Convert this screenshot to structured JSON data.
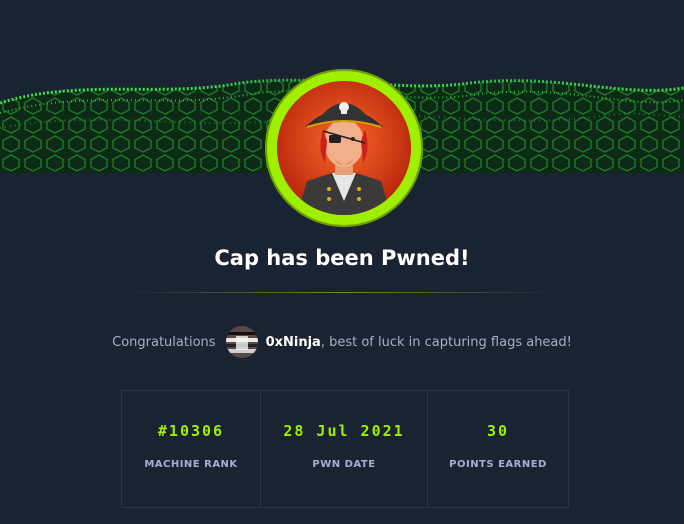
{
  "title": "Cap has been Pwned!",
  "congrats": {
    "prefix": "Congratulations",
    "username": "0xNinja",
    "suffix": ", best of luck in capturing flags ahead!"
  },
  "stats": [
    {
      "value": "#10306",
      "label": "MACHINE RANK"
    },
    {
      "value": "28 Jul 2021",
      "label": "PWN DATE"
    },
    {
      "value": "30",
      "label": "POINTS EARNED"
    }
  ],
  "icons": {
    "banner": "green-hex-wave-banner",
    "machine_avatar": "pirate-avatar",
    "user_avatar": "user-avatar"
  },
  "colors": {
    "background": "#1a2332",
    "accent": "#9fef00",
    "muted_text": "#a4b1cd",
    "border": "#2b3547"
  }
}
